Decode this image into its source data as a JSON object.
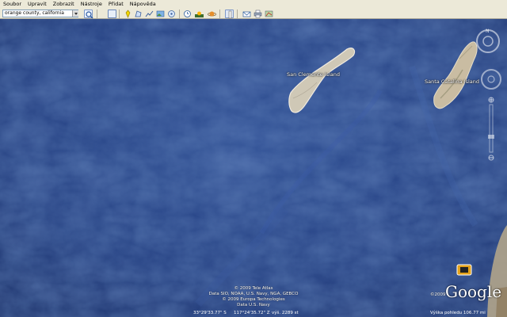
{
  "menu": [
    "Soubor",
    "Upravit",
    "Zobrazit",
    "Nástroje",
    "Přidat",
    "Nápověda"
  ],
  "search": {
    "value": "orange county, california"
  },
  "toolbar_icons": [
    "search-icon",
    "sidebar-toggle-icon",
    "placemark-icon",
    "polygon-icon",
    "path-icon",
    "image-overlay-icon",
    "tour-icon",
    "historical-imagery-icon",
    "sun-icon",
    "planets-icon",
    "ruler-icon",
    "email-icon",
    "print-icon",
    "maps-icon"
  ],
  "map": {
    "labels": {
      "san_clemente": "San Clemente Island",
      "santa_catalina": "Santa Catalina Island"
    },
    "attribution": [
      "© 2009 Tele Atlas",
      "Data SIO, NOAA, U.S. Navy, NGA, GEBCO",
      "© 2009 Europa Technologies",
      "Data U.S. Navy"
    ],
    "year_badge": "©2009",
    "logo": "Google"
  },
  "status": {
    "coords": "33°29'33.77\" S",
    "lon": "117°24'35.72\" Z",
    "elevation": "výš. 2289 st",
    "eye_alt": "Výška pohledu   106.77 mi"
  },
  "colors": {
    "ocean": "#1f3a78",
    "land": "#c9c2b0"
  }
}
